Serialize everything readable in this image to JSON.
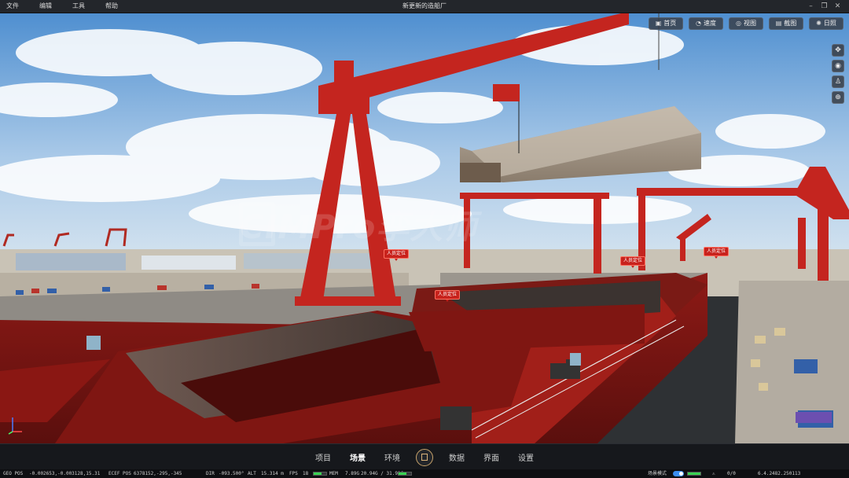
{
  "menu": [
    "文件",
    "编辑",
    "工具",
    "帮助"
  ],
  "window_title": "新更新的造船厂",
  "toolbar": [
    {
      "label": "首页",
      "icon": "image-icon"
    },
    {
      "label": "速度",
      "icon": "speed-gauge-icon"
    },
    {
      "label": "视图",
      "icon": "view-icon"
    },
    {
      "label": "截图",
      "icon": "screenshot-icon"
    },
    {
      "label": "日照",
      "icon": "sun-icon"
    }
  ],
  "side_tools": [
    "move-icon",
    "orbit-icon",
    "walk-icon",
    "globe-icon"
  ],
  "scene_tags": [
    "人员定位",
    "人员定位",
    "人员定位",
    "人员定位"
  ],
  "watermark": "CIMPro孪大师",
  "nav_tabs": [
    "项目",
    "场景",
    "环境",
    "数据",
    "界面",
    "设置"
  ],
  "active_tab": "场景",
  "status": {
    "geo_label": "GEO POS",
    "geo_value": "-0.002653,-0.003128,15.31",
    "ecef_label": "ECEF POS",
    "ecef_value": "6378152,-295,-345",
    "dir_label": "DIR",
    "dir_value": "-093.500°",
    "alt_label": "ALT",
    "alt_value": "15.314 m",
    "fps_label": "FPS",
    "fps_value": "18",
    "mem_label": "MEM",
    "mem_value": "7.89G",
    "gpu_value": "20.94G / 31.91G",
    "mode_label": "场景模式",
    "count_value": "0/0",
    "version": "6.4.2482.250113"
  },
  "colors": {
    "crane_red": "#c4251f",
    "sky": "#7fb2e0",
    "accent_blue": "#3b8df0"
  }
}
